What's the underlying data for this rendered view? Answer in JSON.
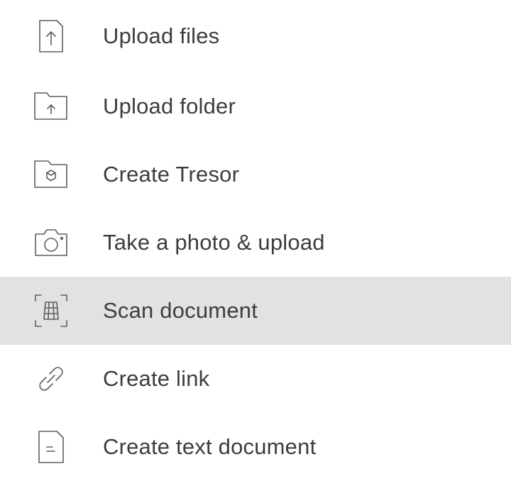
{
  "menu": {
    "items": [
      {
        "icon": "upload-file-icon",
        "label": "Upload files"
      },
      {
        "icon": "upload-folder-icon",
        "label": "Upload folder"
      },
      {
        "icon": "tresor-folder-icon",
        "label": "Create Tresor"
      },
      {
        "icon": "camera-icon",
        "label": "Take a photo & upload"
      },
      {
        "icon": "scan-document-icon",
        "label": "Scan document",
        "highlighted": true
      },
      {
        "icon": "link-icon",
        "label": "Create link"
      },
      {
        "icon": "text-document-icon",
        "label": "Create text document"
      }
    ],
    "colors": {
      "text": "#3d3d3d",
      "icon": "#5f5f5f",
      "highlight": "#e2e2e4",
      "background": "#ffffff"
    }
  }
}
